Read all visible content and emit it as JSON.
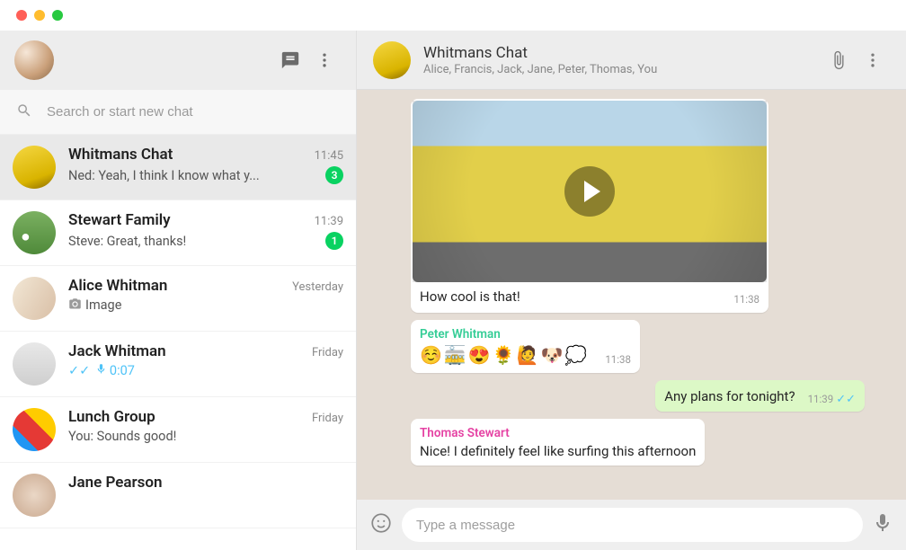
{
  "search": {
    "placeholder": "Search or start new chat"
  },
  "header": {
    "title": "Whitmans Chat",
    "subtitle": "Alice, Francis, Jack, Jane, Peter, Thomas, You"
  },
  "composer": {
    "placeholder": "Type a message"
  },
  "chats": [
    {
      "name": "Whitmans Chat",
      "time": "11:45",
      "preview": "Ned: Yeah, I think I know what y...",
      "unread": "3"
    },
    {
      "name": "Stewart Family",
      "time": "11:39",
      "preview": "Steve: Great, thanks!",
      "unread": "1"
    },
    {
      "name": "Alice Whitman",
      "time": "Yesterday",
      "preview": "Image"
    },
    {
      "name": "Jack Whitman",
      "time": "Friday",
      "preview": "0:07"
    },
    {
      "name": "Lunch Group",
      "time": "Friday",
      "preview": "You: Sounds good!"
    },
    {
      "name": "Jane Pearson",
      "time": ""
    }
  ],
  "messages": {
    "m0": {
      "text": "How cool is that!",
      "time": "11:38"
    },
    "m1": {
      "sender": "Peter Whitman",
      "text": "☺️🚋😍🌻🙋🐶💭",
      "time": "11:38"
    },
    "m2": {
      "text": "Any plans for tonight?",
      "time": "11:39"
    },
    "m3": {
      "sender": "Thomas Stewart",
      "text": "Nice! I definitely feel like surfing this afternoon"
    }
  }
}
